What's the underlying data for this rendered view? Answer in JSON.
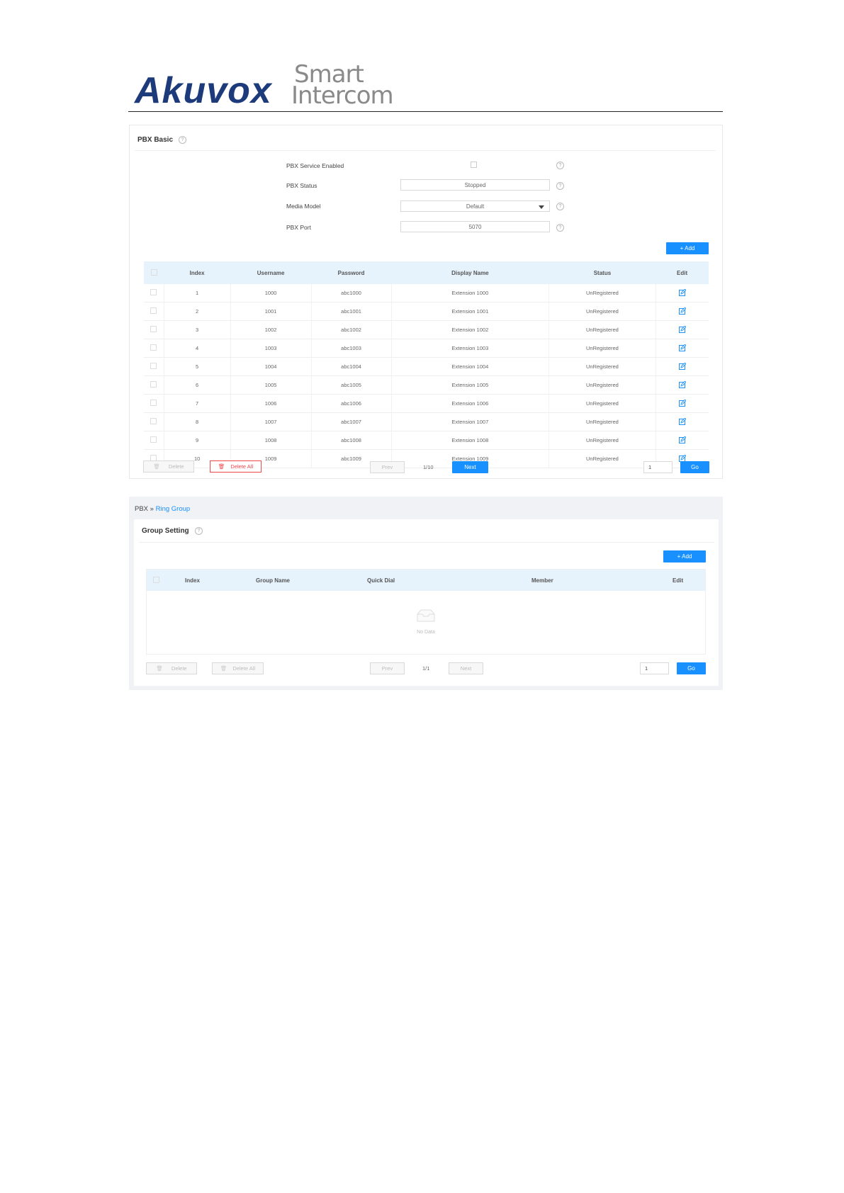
{
  "logo": {
    "brand": "Akuvox",
    "line1": "Smart",
    "line2": "Intercom"
  },
  "pbx_basic": {
    "title": "PBX Basic",
    "help": "?",
    "fields": {
      "service_enabled_label": "PBX Service Enabled",
      "status_label": "PBX Status",
      "status_value": "Stopped",
      "media_model_label": "Media Model",
      "media_model_value": "Default",
      "port_label": "PBX Port",
      "port_value": "5070"
    },
    "add_label": "+ Add",
    "columns": [
      "Index",
      "Username",
      "Password",
      "Display Name",
      "Status",
      "Edit"
    ],
    "rows": [
      {
        "index": "1",
        "username": "1000",
        "password": "abc1000",
        "display": "Extension 1000",
        "status": "UnRegistered"
      },
      {
        "index": "2",
        "username": "1001",
        "password": "abc1001",
        "display": "Extension 1001",
        "status": "UnRegistered"
      },
      {
        "index": "3",
        "username": "1002",
        "password": "abc1002",
        "display": "Extension 1002",
        "status": "UnRegistered"
      },
      {
        "index": "4",
        "username": "1003",
        "password": "abc1003",
        "display": "Extension 1003",
        "status": "UnRegistered"
      },
      {
        "index": "5",
        "username": "1004",
        "password": "abc1004",
        "display": "Extension 1004",
        "status": "UnRegistered"
      },
      {
        "index": "6",
        "username": "1005",
        "password": "abc1005",
        "display": "Extension 1005",
        "status": "UnRegistered"
      },
      {
        "index": "7",
        "username": "1006",
        "password": "abc1006",
        "display": "Extension 1006",
        "status": "UnRegistered"
      },
      {
        "index": "8",
        "username": "1007",
        "password": "abc1007",
        "display": "Extension 1007",
        "status": "UnRegistered"
      },
      {
        "index": "9",
        "username": "1008",
        "password": "abc1008",
        "display": "Extension 1008",
        "status": "UnRegistered"
      },
      {
        "index": "10",
        "username": "1009",
        "password": "abc1009",
        "display": "Extension 1009",
        "status": "UnRegistered"
      }
    ],
    "pager": {
      "delete": "Delete",
      "delete_all": "Delete All",
      "prev": "Prev",
      "page": "1/10",
      "next": "Next",
      "goto_value": "1",
      "go": "Go"
    }
  },
  "ring_group": {
    "breadcrumb_root": "PBX",
    "breadcrumb_sep": "»",
    "breadcrumb_current": "Ring Group",
    "title": "Group Setting",
    "help": "?",
    "add_label": "+ Add",
    "columns": [
      "Index",
      "Group Name",
      "Quick Dial",
      "Member",
      "Edit"
    ],
    "empty_text": "No Data",
    "pager": {
      "delete": "Delete",
      "delete_all": "Delete All",
      "prev": "Prev",
      "page": "1/1",
      "next": "Next",
      "goto_value": "1",
      "go": "Go"
    }
  },
  "colors": {
    "primary": "#1890ff",
    "danger": "#e02020",
    "brand": "#1d3a7a",
    "header_bg": "#e6f2fc"
  }
}
